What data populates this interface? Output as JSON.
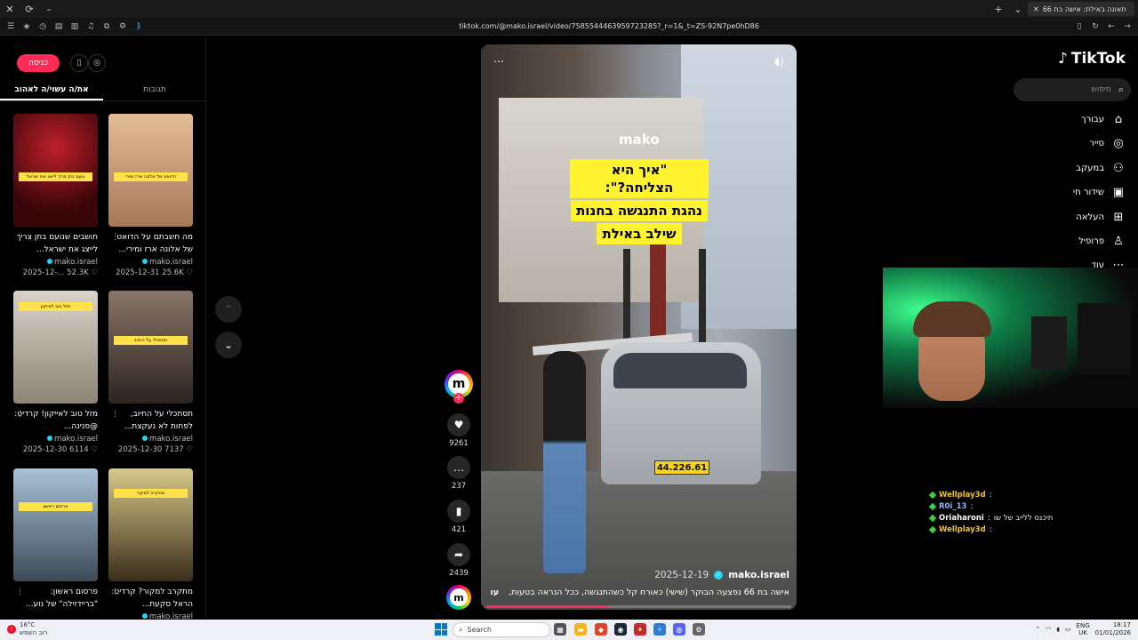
{
  "browser": {
    "tab_title": "תאונה באילת: אישה בת 66",
    "url": "tiktok.com/@mako.israel/video/7585544463959723285?_r=1&_t=ZS-92N7pe0hD86"
  },
  "left_panel": {
    "login_label": "כניסה",
    "tabs": [
      "תגובות",
      "את/ה עשוי/ה לאהוב"
    ],
    "cards": [
      {
        "title": "חושבים שנועם בתן צריך לייצג את ישראל...",
        "author": "mako.israel",
        "date": "2025-12-...",
        "likes": "52.3K",
        "caption": "נועם בתן צריך לייצג את ישראל",
        "thumb_color": "#5a0f12"
      },
      {
        "title": "מה חשבתם על הדואט של אלונה ארז ומירי...",
        "author": "mako.israel",
        "date": "2025-12-31",
        "likes": "25.6K",
        "caption": "הדואט של אלונה ארז ומירי",
        "thumb_color": "#d4a07a"
      },
      {
        "title": "מזל טוב לאייקון! קרדיט: @פנינה...",
        "author": "mako.israel",
        "date": "2025-12-30",
        "likes": "6114",
        "caption": "מזל טוב לאייקון",
        "thumb_color": "#c9c2b6"
      },
      {
        "title": "תסתכלי על החיוב, לפחות לא נעקצת...",
        "author": "mako.israel",
        "date": "2025-12-30",
        "likes": "7137",
        "caption": "תסתכלי על החיוב",
        "thumb_color": "#6e5e54"
      },
      {
        "title": "פרסום ראשון: \"בריידזילה\" של נוע...",
        "author": "mako.israel",
        "date": "",
        "likes": "",
        "caption": "פרסום ראשון",
        "thumb_color": "#4f6a85"
      },
      {
        "title": "מתקרב למקור? קרדיט: הראל סקעת...",
        "author": "mako.israel",
        "date": "",
        "likes": "",
        "caption": "מתקרב למקור",
        "thumb_color": "#7a6a3a"
      }
    ]
  },
  "video": {
    "brand": "mako",
    "headline": [
      "\"איך היא הצליחה?\":",
      "נהגת התנגשה בחנות",
      "שילב באילת"
    ],
    "plate": "44.226.61",
    "author": "mako.israel",
    "date": "2025-12-19",
    "caption": "אישה בת 66 נפצעה הבוקר (שישי) כאורח קל כשהתנגשה, ככל הנראה בטעות,",
    "more_label": "עוד",
    "progress": 0.4
  },
  "actions": {
    "likes": "9261",
    "comments": "237",
    "saves": "421",
    "shares": "2439"
  },
  "right_nav": {
    "logo": "TikTok",
    "search_placeholder": "חיפוש",
    "items": [
      "עבורך",
      "סייר",
      "במעקב",
      "שידור חי",
      "העלאה",
      "פרופיל",
      "עוד"
    ]
  },
  "chat": [
    {
      "user": "Wellplay3d",
      "msg": "",
      "color": "#f0c419"
    },
    {
      "user": "R0i_13",
      "msg": "",
      "color": "#8ab4ff"
    },
    {
      "user": "Oriaharoni",
      "msg": "תיכנס ללייב של שו",
      "color": "#ffffff"
    },
    {
      "user": "Wellplay3d",
      "msg": "",
      "color": "#f0c419"
    }
  ],
  "taskbar": {
    "weather_temp": "16°C",
    "weather_desc": "רוב השמש",
    "search_label": "Search",
    "lang": "ENG",
    "lang_sub": "UK",
    "time": "18:17",
    "date": "01/01/2026"
  }
}
